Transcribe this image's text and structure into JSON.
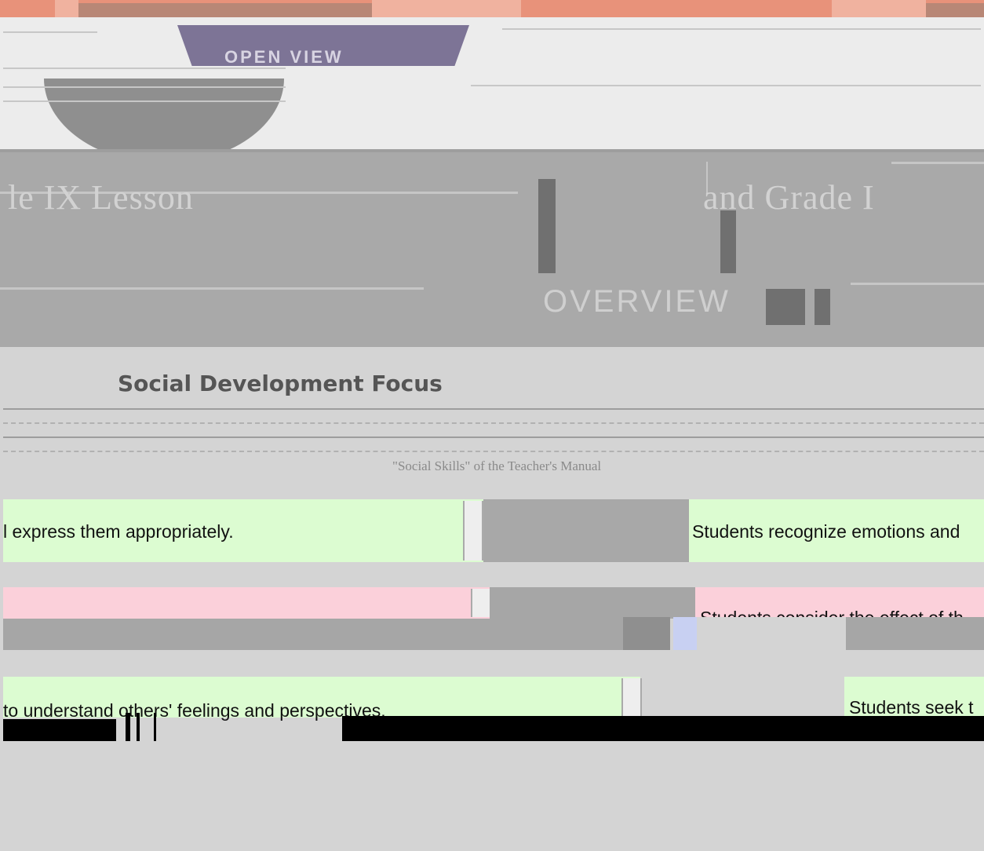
{
  "header": {
    "logo_text": "OPEN VIEW",
    "tagline": ""
  },
  "title_band": {
    "lesson_label": "le IX Lesson",
    "grade_label": "and Grade I",
    "overview_label": "OVERVIEW"
  },
  "section": {
    "title": "Social Development Focus",
    "caption": "\"Social Skills\" of the Teacher's Manual"
  },
  "rows": [
    {
      "left_text": "l express them appropriately.",
      "right_text": "Students recognize emotions and",
      "color": "green"
    },
    {
      "left_text": "",
      "right_text": "Students consider the effect of th",
      "color": "pink"
    },
    {
      "left_text": "to understand others' feelings and perspectives.",
      "right_text": "Students seek t",
      "color": "green"
    }
  ],
  "colors": {
    "stripe": "#e8927a",
    "title_band": "#a9a9a9",
    "row_green": "#dcfcd1",
    "row_pink": "#fbd0da"
  }
}
